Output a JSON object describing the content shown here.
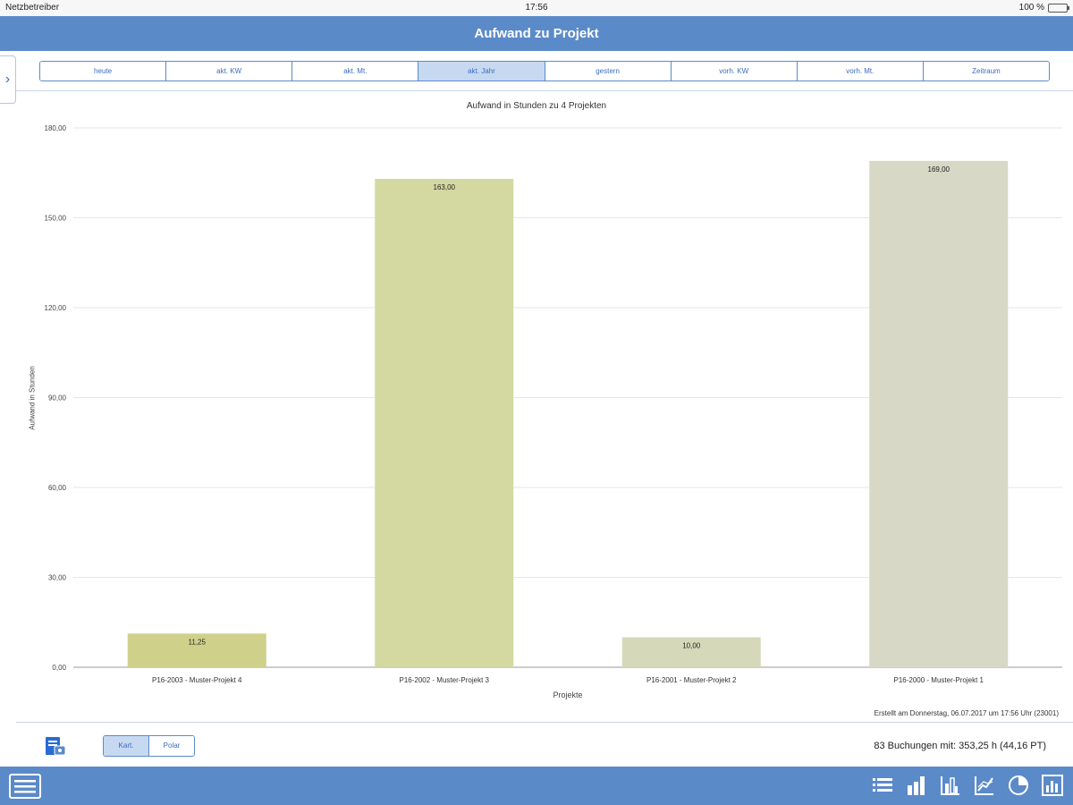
{
  "status_bar": {
    "carrier": "Netzbetreiber",
    "time": "17:56",
    "battery": "100 %"
  },
  "title": "Aufwand zu Projekt",
  "segments": [
    {
      "label": "heute",
      "active": false
    },
    {
      "label": "akt. KW",
      "active": false
    },
    {
      "label": "akt. Mt.",
      "active": false
    },
    {
      "label": "akt. Jahr",
      "active": true
    },
    {
      "label": "gestern",
      "active": false
    },
    {
      "label": "vorh. KW",
      "active": false
    },
    {
      "label": "vorh. Mt.",
      "active": false
    },
    {
      "label": "Zeitraum",
      "active": false
    }
  ],
  "chart_data": {
    "type": "bar",
    "title": "Aufwand in Stunden zu 4 Projekten",
    "xlabel": "Projekte",
    "ylabel": "Aufwand in Stunden",
    "categories": [
      "P16-2003 - Muster-Projekt 4",
      "P16-2002 - Muster-Projekt 3",
      "P16-2001 - Muster-Projekt 2",
      "P16-2000 - Muster-Projekt 1"
    ],
    "values": [
      11.25,
      163.0,
      10.0,
      169.0
    ],
    "value_labels": [
      "11,25",
      "163,00",
      "10,00",
      "169,00"
    ],
    "colors": [
      "#cfd18b",
      "#d3d9a1",
      "#d5d8b9",
      "#d7d8c6"
    ],
    "ylim": [
      0,
      180
    ],
    "yticks": [
      0,
      30,
      60,
      90,
      120,
      150,
      180
    ],
    "ytick_labels": [
      "0,00",
      "30,00",
      "60,00",
      "90,00",
      "120,00",
      "150,00",
      "180,00"
    ],
    "grid": true
  },
  "footnote": "Erstellt am Donnerstag, 06.07.2017 um 17:56 Uhr (23001)",
  "toggle": [
    {
      "label": "Kart.",
      "active": true
    },
    {
      "label": "Polar",
      "active": false
    }
  ],
  "summary": "83 Buchungen mit: 353,25 h (44,16 PT)",
  "tab_icons": [
    "list-icon",
    "bar-chart-icon",
    "stacked-chart-icon",
    "line-chart-icon",
    "pie-chart-icon",
    "report-chart-icon"
  ]
}
